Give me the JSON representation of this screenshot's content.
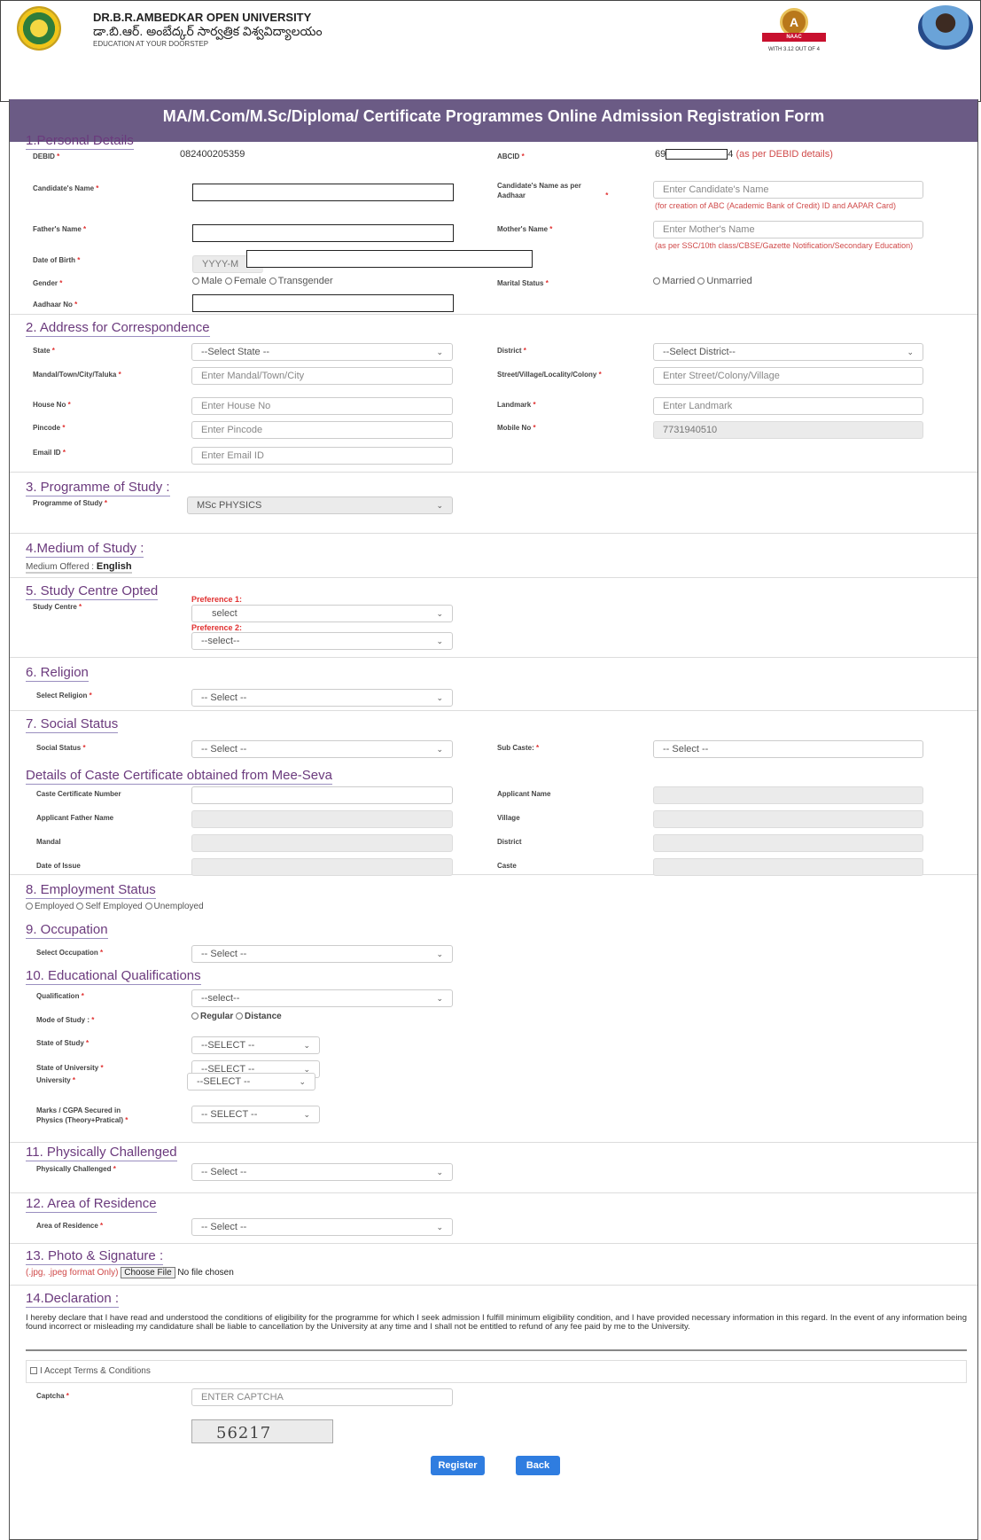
{
  "header": {
    "university": "DR.B.R.AMBEDKAR OPEN UNIVERSITY",
    "telugu": "డా.బి.ఆర్. అంబేద్కర్ సార్వత్రిక విశ్వవిద్యాలయం",
    "tagline": "EDUCATION AT YOUR DOORSTEP",
    "naac_grade": "A",
    "naac_label": "NAAC",
    "naac_text": "WITH 3.12 OUT OF 4"
  },
  "form_title": "MA/M.Com/M.Sc/Diploma/ Certificate Programmes Online Admission Registration Form",
  "req": "*",
  "personal": {
    "title": "1.Personal Details",
    "debid_label": "DEBID",
    "debid_value": "082400205359",
    "abcid_label": "ABCID",
    "abcid_value": "69",
    "abcid_suffix": "4",
    "abcid_note": "(as per DEBID details)",
    "cand_name_label": "Candidate's Name",
    "cand_aadhaar_label": "Candidate's Name as per Aadhaar",
    "cand_aadhaar_placeholder": "Enter Candidate's Name",
    "cand_aadhaar_note": "(for creation of ABC (Academic Bank of Credit) ID and AAPAR Card)",
    "father_label": "Father's Name",
    "mother_label": "Mother's Name",
    "mother_placeholder": "Enter Mother's Name",
    "mother_note": "(as per SSC/10th class/CBSE/Gazette Notification/Secondary Education)",
    "dob_label": "Date of Birth",
    "dob_placeholder": "YYYY-M",
    "gender_label": "Gender",
    "gender_options": [
      "Male",
      "Female",
      "Transgender"
    ],
    "marital_label": "Marital Status",
    "marital_options": [
      "Married",
      "Unmarried"
    ],
    "aadhaar_label": "Aadhaar No"
  },
  "address": {
    "title": "2. Address for Correspondence",
    "state_label": "State",
    "state_value": "--Select State --",
    "district_label": "District",
    "district_value": "--Select District--",
    "mandal_label": "Mandal/Town/City/Taluka",
    "mandal_placeholder": "Enter Mandal/Town/City",
    "street_label": "Street/Village/Locality/Colony",
    "street_placeholder": "Enter Street/Colony/Village",
    "house_label": "House No",
    "house_placeholder": "Enter House No",
    "landmark_label": "Landmark",
    "landmark_placeholder": "Enter Landmark",
    "pincode_label": "Pincode",
    "pincode_placeholder": "Enter Pincode",
    "mobile_label": "Mobile No",
    "mobile_value": "7731940510",
    "email_label": "Email ID",
    "email_placeholder": "Enter Email ID"
  },
  "programme": {
    "title": "3. Programme of Study :",
    "label": "Programme of Study",
    "value": "MSc PHYSICS"
  },
  "medium": {
    "title": "4.Medium of Study :",
    "label": "Medium Offered : ",
    "value": "English"
  },
  "study_centre": {
    "title": "5. Study Centre Opted",
    "label": "Study Centre",
    "pref1": "Preference 1:",
    "pref1_value": "select",
    "pref2": "Preference 2:",
    "pref2_value": "--select--"
  },
  "religion": {
    "title": "6. Religion",
    "label": "Select Religion",
    "value": "-- Select --"
  },
  "social": {
    "title": "7. Social Status",
    "label": "Social Status",
    "value": "-- Select --",
    "subcaste_label": "Sub Caste:",
    "subcaste_value": "-- Select --"
  },
  "caste_cert": {
    "title": "Details of Caste Certificate obtained from Mee-Seva",
    "cert_no": "Caste Certificate Number",
    "applicant": "Applicant Name",
    "father": "Applicant Father Name",
    "village": "Village",
    "mandal": "Mandal",
    "district": "District",
    "issue_date": "Date of Issue",
    "caste": "Caste"
  },
  "employment": {
    "title": "8. Employment Status",
    "options": [
      "Employed",
      "Self Employed",
      "Unemployed"
    ]
  },
  "occupation": {
    "title": "9. Occupation",
    "label": "Select Occupation",
    "value": "-- Select --"
  },
  "education": {
    "title": "10. Educational Qualifications",
    "qual_label": "Qualification",
    "qual_value": "--select--",
    "mode_label": "Mode of Study :",
    "mode_options": [
      "Regular",
      "Distance"
    ],
    "state_label": "State of Study",
    "state_value": "--SELECT --",
    "state_univ_label": "State of University",
    "state_univ_value": "--SELECT --",
    "university_label": "University",
    "university_value": "--SELECT --",
    "marks_label_1": "Marks / CGPA Secured in",
    "marks_label_2": "Physics (Theory+Pratical)",
    "marks_value": "-- SELECT --"
  },
  "physically": {
    "title": "11. Physically Challenged",
    "label": "Physically Challenged",
    "value": "-- Select --"
  },
  "residence": {
    "title": "12. Area of Residence",
    "label": "Area of Residence",
    "value": "-- Select --"
  },
  "photo": {
    "title": "13. Photo & Signature :",
    "hint": "(.jpg, .jpeg format Only)",
    "button": "Choose File",
    "status": "No file chosen"
  },
  "declaration": {
    "title": "14.Declaration :",
    "text": "I hereby declare that I have read and understood the conditions of eligibility for the programme for which I seek admission I fulfill minimum eligibility condition, and I have provided necessary information in this regard. In the event of any information being found incorrect or misleading my candidature shall be liable to cancellation by the University at any time and I shall not be entitled to refund of any fee paid by me to the University.",
    "accept": "I Accept Terms & Conditions",
    "captcha_label": "Captcha",
    "captcha_placeholder": "ENTER CAPTCHA",
    "captcha_code": "56217"
  },
  "buttons": {
    "register": "Register",
    "back": "Back"
  },
  "colors": {
    "title_bar": "#6b5b85",
    "section_title": "#6b3a7d",
    "required": "#e03030",
    "button": "#2f7de0"
  }
}
